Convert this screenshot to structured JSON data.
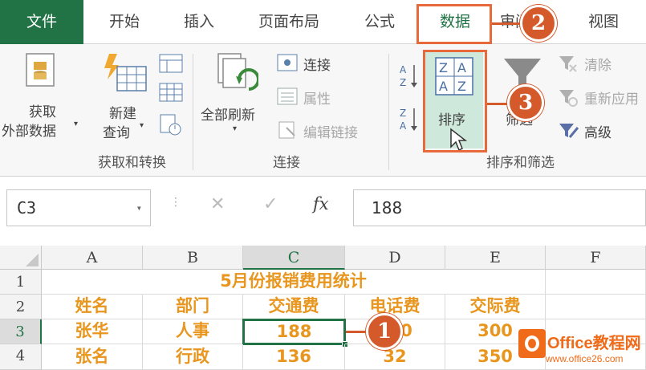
{
  "tabs": [
    "文件",
    "开始",
    "插入",
    "页面布局",
    "公式",
    "数据",
    "审阅",
    "视图"
  ],
  "ribbon": {
    "get_external": [
      "获取",
      "外部数据"
    ],
    "new_query": [
      "新建",
      "查询"
    ],
    "group_get_transform": "获取和转换",
    "refresh_all": "全部刷新",
    "connections": "连接",
    "properties": "属性",
    "edit_links": "编辑链接",
    "group_connections": "连接",
    "sort": "排序",
    "filter": "筛选",
    "clear": "清除",
    "reapply": "重新应用",
    "advanced": "高级",
    "group_sort_filter": "排序和筛选"
  },
  "formula_bar": {
    "namebox": "C3",
    "cancel": "✕",
    "enter": "✓",
    "fx": "fx",
    "value": "188"
  },
  "sheet": {
    "columns": [
      "A",
      "B",
      "C",
      "D",
      "E",
      "F"
    ],
    "rows": [
      "1",
      "2",
      "3",
      "4"
    ],
    "title": "5月份报销费用统计",
    "headers": [
      "姓名",
      "部门",
      "交通费",
      "电话费",
      "交际费"
    ],
    "data": [
      [
        "张华",
        "人事",
        "188",
        "130",
        "300"
      ],
      [
        "张名",
        "行政",
        "136",
        "32",
        "350"
      ]
    ]
  },
  "callouts": [
    "1",
    "2",
    "3"
  ],
  "watermark": {
    "brand": "Office教程网",
    "url": "www.office26.com"
  },
  "colors": {
    "accent": "#217346",
    "callout": "#d45a2c",
    "cell_text": "#e8961e"
  }
}
